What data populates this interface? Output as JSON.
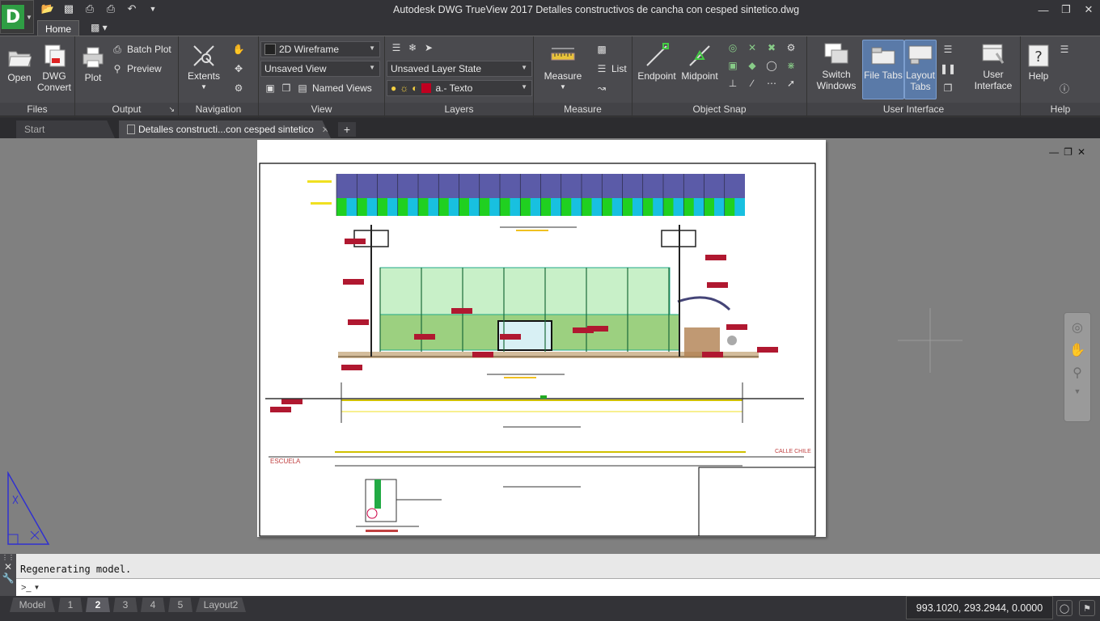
{
  "title_bar": {
    "app_letter": "D",
    "title": "Autodesk DWG TrueView 2017    Detalles constructivos de cancha con cesped sintetico.dwg"
  },
  "ribbon_tabs": {
    "home": "Home"
  },
  "panels": {
    "files": {
      "label": "Files",
      "open": "Open",
      "dwg_convert_1": "DWG",
      "dwg_convert_2": "Convert"
    },
    "output": {
      "label": "Output",
      "plot": "Plot",
      "batch_plot": "Batch Plot",
      "preview": "Preview"
    },
    "navigation": {
      "label": "Navigation",
      "extents": "Extents"
    },
    "view": {
      "label": "View",
      "visual_style": "2D Wireframe",
      "named_view": "Unsaved View",
      "named_views": "Named Views"
    },
    "layers": {
      "label": "Layers",
      "layer_state": "Unsaved Layer State",
      "current_layer": "a.- Texto"
    },
    "measure": {
      "label": "Measure",
      "measure": "Measure",
      "list": "List"
    },
    "object_snap": {
      "label": "Object Snap",
      "endpoint": "Endpoint",
      "midpoint": "Midpoint"
    },
    "user_interface": {
      "label": "User Interface",
      "switch_1": "Switch",
      "switch_2": "Windows",
      "file_tabs": "File Tabs",
      "layout_1": "Layout",
      "layout_2": "Tabs",
      "ui_1": "User",
      "ui_2": "Interface"
    },
    "help": {
      "label": "Help",
      "help": "Help"
    }
  },
  "file_tabs": {
    "start": "Start",
    "document": "Detalles constructi...con cesped sintetico"
  },
  "drawing_labels": {
    "escuela": "ESCUELA",
    "calle": "CALLE CHILE"
  },
  "command_line": {
    "history": "Regenerating model.",
    "prompt": ">_"
  },
  "layout_tabs": [
    "Model",
    "1",
    "2",
    "3",
    "4",
    "5",
    "Layout2"
  ],
  "active_layout": "2",
  "status": {
    "coordinates": "993.1020, 293.2944, 0.0000"
  },
  "colors": {
    "ribbon_bg": "#4a4a4e",
    "canvas_bg": "#808080",
    "active_button": "#5a7aa8",
    "app_logo": "#2f9e44"
  }
}
